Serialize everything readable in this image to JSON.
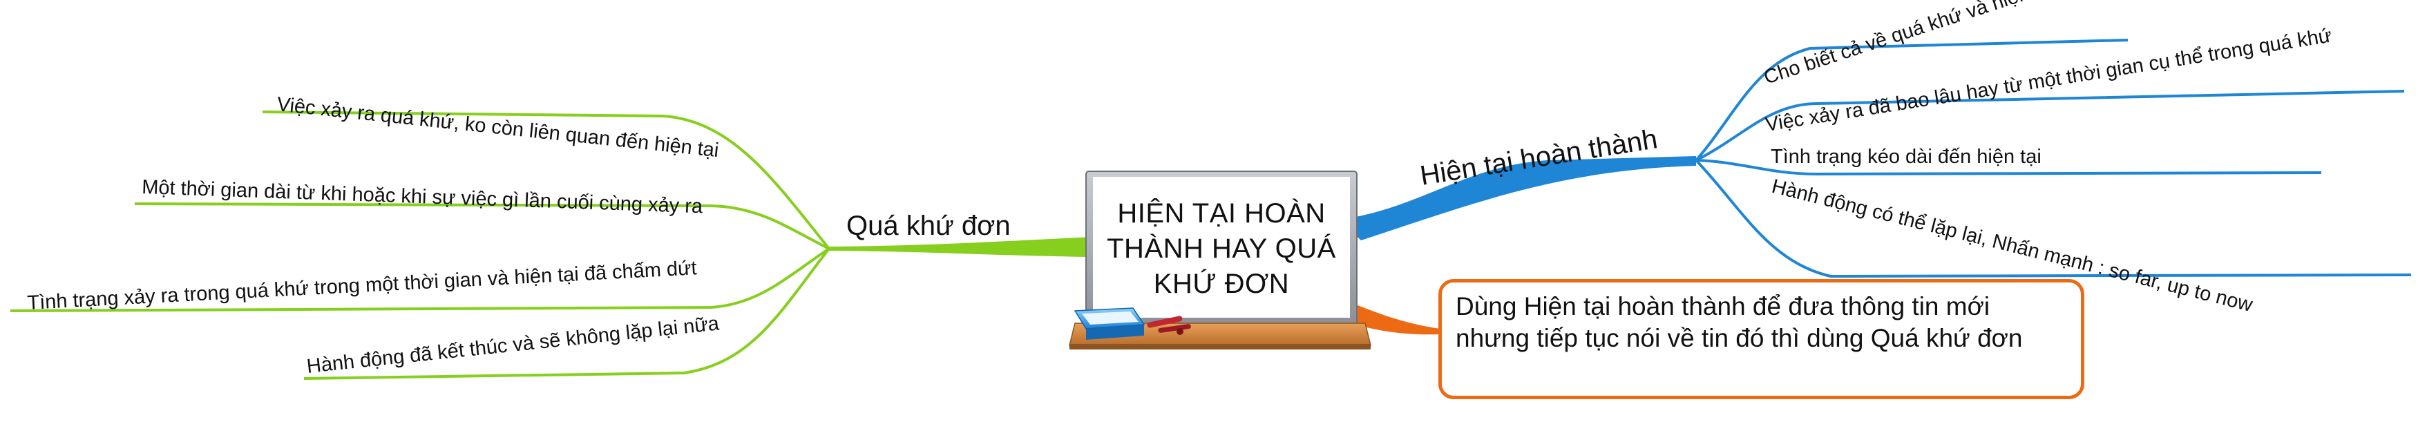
{
  "central_topic": {
    "lines": [
      "HIỆN TẠI HOÀN",
      "THÀNH HAY QUÁ",
      "KHỨ ĐƠN"
    ]
  },
  "branches": {
    "present_perfect": {
      "label": "Hiện tại hoàn thành",
      "color": "#1f86d6",
      "items": [
        "Cho biết cả về quá khứ và hiện tại",
        "Việc xảy ra đã bao lâu hay từ một thời gian cụ thể trong quá khứ",
        "Tình trạng kéo dài đến hiện tại",
        "Hành động có thể lặp lại, Nhấn mạnh : so far, up to now"
      ]
    },
    "past_simple": {
      "label": "Quá khứ đơn",
      "color": "#86cf1e",
      "items": [
        "Việc xảy ra quá khứ, ko còn liên quan đến hiện tại",
        "Một thời gian dài từ khi hoặc khi sự việc gì lần cuối cùng xảy ra",
        "Tình trạng xảy ra trong quá khứ trong một thời gian và hiện tại đã chấm dứt",
        "Hành động đã kết thúc và sẽ không lặp lại nữa"
      ]
    },
    "note": {
      "color": "#ec6a14",
      "text": "Dùng Hiện tại hoàn thành để đưa thông tin mới nhưng tiếp tục nói về tin đó thì dùng Quá khứ đơn"
    }
  }
}
